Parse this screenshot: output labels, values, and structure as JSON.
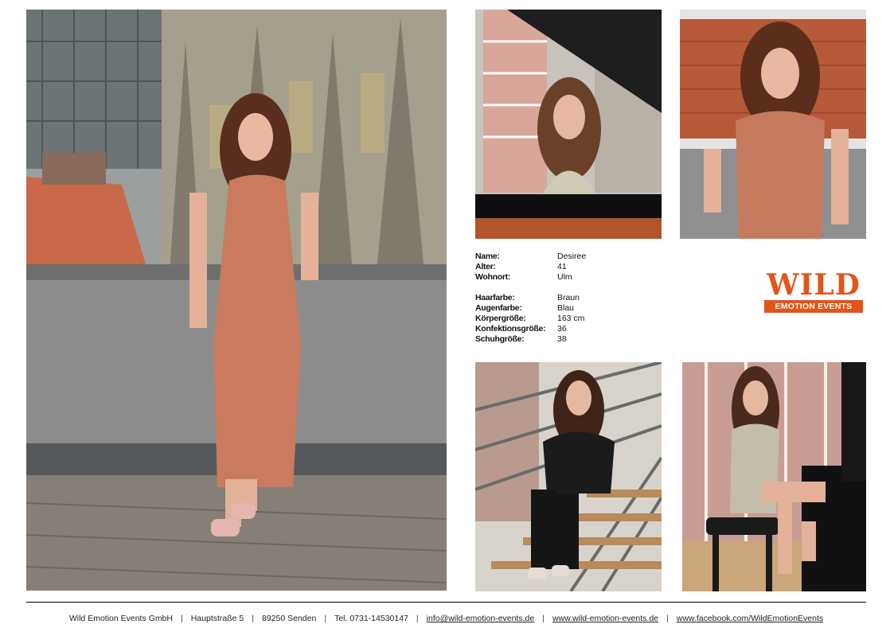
{
  "profile": {
    "rows": [
      {
        "label": "Name:",
        "value": "Desiree"
      },
      {
        "label": "Alter:",
        "value": "41"
      },
      {
        "label": "Wohnort:",
        "value": "Ulm"
      },
      {
        "label": "Haarfarbe:",
        "value": "Braun"
      },
      {
        "label": "Augenfarbe:",
        "value": "Blau"
      },
      {
        "label": "Körpergröße:",
        "value": "163 cm"
      },
      {
        "label": "Konfektionsgröße:",
        "value": "36"
      },
      {
        "label": "Schuhgröße:",
        "value": "38"
      }
    ]
  },
  "logo": {
    "word": "WILD",
    "tagline": "EMOTION EVENTS",
    "color": "#e25418"
  },
  "footer": {
    "company": "Wild Emotion Events GmbH",
    "street": "Hauptstraße 5",
    "city": "89250 Senden",
    "phone": "Tel. 0731-14530147",
    "email": "info@wild-emotion-events.de",
    "website": "www.wild-emotion-events.de",
    "facebook": "www.facebook.com/WildEmotionEvents",
    "separator": "|"
  }
}
